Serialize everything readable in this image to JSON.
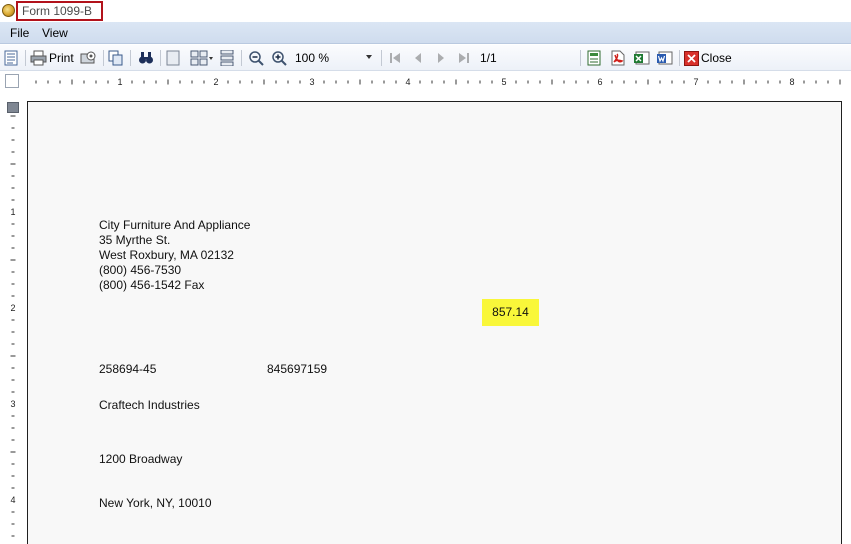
{
  "window": {
    "title": "Form 1099-B"
  },
  "menu": {
    "file": "File",
    "view": "View"
  },
  "toolbar": {
    "print_label": "Print",
    "zoom_value": "100 %",
    "page_indicator": "1/1",
    "close_label": "Close"
  },
  "ruler": {
    "marks": [
      "1",
      "2",
      "3",
      "4",
      "5",
      "6",
      "7",
      "8"
    ],
    "vmarks": [
      "1",
      "2",
      "3",
      "4"
    ]
  },
  "document": {
    "payer": {
      "name": "City Furniture And Appliance",
      "street": "35 Myrthe St.",
      "city_state_zip": "West Roxbury,  MA  02132",
      "phone": "(800) 456-7530",
      "fax": "(800) 456-1542 Fax"
    },
    "amount": "857.14",
    "payer_tin": "258694-45",
    "recipient_tin": "845697159",
    "recipient_name": "Craftech Industries",
    "recipient_street": "1200 Broadway",
    "recipient_city": "New York, NY, 10010"
  },
  "colors": {
    "highlight": "#f9f73a",
    "title_border": "#b2121b",
    "menu_bg": "#dbe6f4"
  }
}
